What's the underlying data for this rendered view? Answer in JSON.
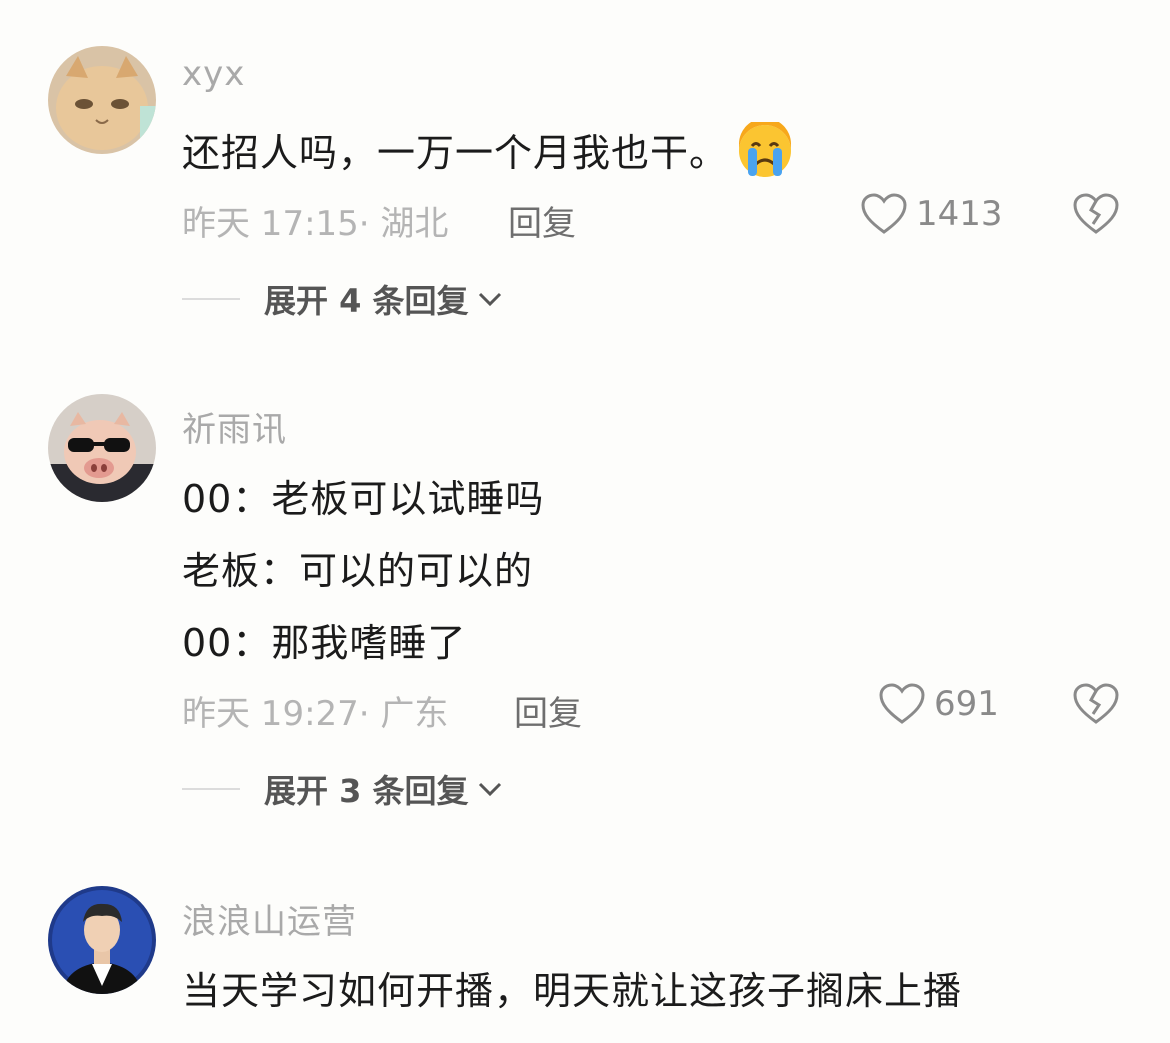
{
  "comments": [
    {
      "username": "xyx",
      "lines": [
        "还招人吗，一万一个月我也干。"
      ],
      "emoji": "crying-face-icon",
      "time": "昨天 17:15",
      "location": "湖北",
      "reply_label": "回复",
      "likes": "1413",
      "expand_label": "展开 4 条回复"
    },
    {
      "username": "祈雨讯",
      "lines": [
        "00：老板可以试睡吗",
        "老板：可以的可以的",
        "00：那我嗜睡了"
      ],
      "time": "昨天 19:27",
      "location": "广东",
      "reply_label": "回复",
      "likes": "691",
      "expand_label": "展开 3 条回复"
    },
    {
      "username": "浪浪山运营",
      "lines": [
        "当天学习如何开播，明天就让这孩子搁床上播"
      ]
    }
  ],
  "colors": {
    "background": "#fdfdfb",
    "username": "#a9a9a9",
    "text": "#1b1b1b",
    "meta": "#b4b4b4"
  }
}
